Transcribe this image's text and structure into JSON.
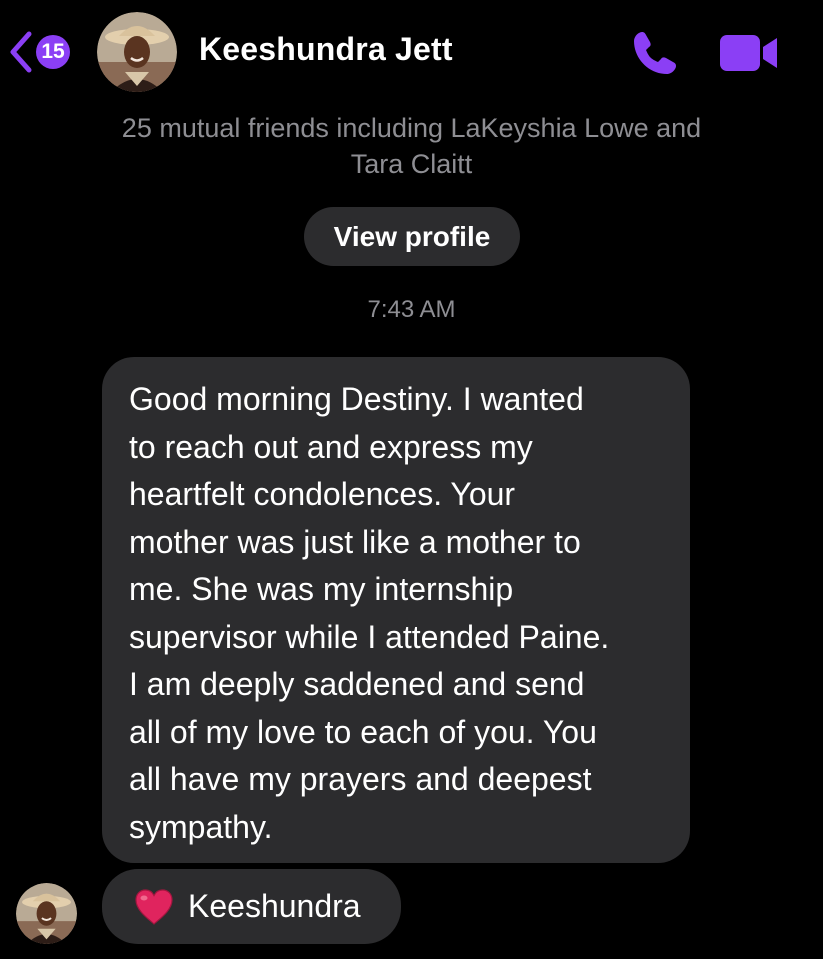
{
  "header": {
    "back_count": "15",
    "contact_name": "Keeshundra Jett",
    "accent_color": "#8b3ff5"
  },
  "profile_info": {
    "mutual_friends_line1": "25 mutual friends including LaKeyshia Lowe and",
    "mutual_friends_line2": "Tara Claitt",
    "view_profile_label": "View profile"
  },
  "conversation": {
    "timestamp": "7:43 AM",
    "message_lines": [
      "Good morning Destiny. I wanted",
      "to reach out and express my",
      "heartfelt condolences. Your",
      "mother was just like a mother to",
      "me. She was my internship",
      "supervisor while I attended Paine.",
      "I am deeply saddened and send",
      "all of my love to each of you. You",
      "all have my prayers and deepest",
      "sympathy."
    ],
    "reaction": {
      "emoji_icon": "red-heart-icon",
      "label": "Keeshundra"
    }
  }
}
